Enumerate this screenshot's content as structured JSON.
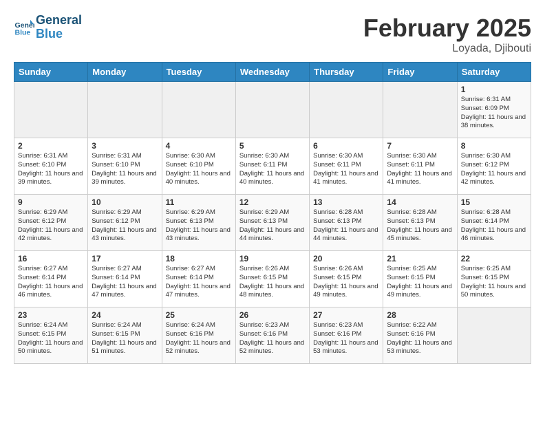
{
  "header": {
    "logo_line1": "General",
    "logo_line2": "Blue",
    "title": "February 2025",
    "subtitle": "Loyada, Djibouti"
  },
  "weekdays": [
    "Sunday",
    "Monday",
    "Tuesday",
    "Wednesday",
    "Thursday",
    "Friday",
    "Saturday"
  ],
  "weeks": [
    [
      {
        "day": "",
        "info": ""
      },
      {
        "day": "",
        "info": ""
      },
      {
        "day": "",
        "info": ""
      },
      {
        "day": "",
        "info": ""
      },
      {
        "day": "",
        "info": ""
      },
      {
        "day": "",
        "info": ""
      },
      {
        "day": "1",
        "info": "Sunrise: 6:31 AM\nSunset: 6:09 PM\nDaylight: 11 hours and 38 minutes."
      }
    ],
    [
      {
        "day": "2",
        "info": "Sunrise: 6:31 AM\nSunset: 6:10 PM\nDaylight: 11 hours and 39 minutes."
      },
      {
        "day": "3",
        "info": "Sunrise: 6:31 AM\nSunset: 6:10 PM\nDaylight: 11 hours and 39 minutes."
      },
      {
        "day": "4",
        "info": "Sunrise: 6:30 AM\nSunset: 6:10 PM\nDaylight: 11 hours and 40 minutes."
      },
      {
        "day": "5",
        "info": "Sunrise: 6:30 AM\nSunset: 6:11 PM\nDaylight: 11 hours and 40 minutes."
      },
      {
        "day": "6",
        "info": "Sunrise: 6:30 AM\nSunset: 6:11 PM\nDaylight: 11 hours and 41 minutes."
      },
      {
        "day": "7",
        "info": "Sunrise: 6:30 AM\nSunset: 6:11 PM\nDaylight: 11 hours and 41 minutes."
      },
      {
        "day": "8",
        "info": "Sunrise: 6:30 AM\nSunset: 6:12 PM\nDaylight: 11 hours and 42 minutes."
      }
    ],
    [
      {
        "day": "9",
        "info": "Sunrise: 6:29 AM\nSunset: 6:12 PM\nDaylight: 11 hours and 42 minutes."
      },
      {
        "day": "10",
        "info": "Sunrise: 6:29 AM\nSunset: 6:12 PM\nDaylight: 11 hours and 43 minutes."
      },
      {
        "day": "11",
        "info": "Sunrise: 6:29 AM\nSunset: 6:13 PM\nDaylight: 11 hours and 43 minutes."
      },
      {
        "day": "12",
        "info": "Sunrise: 6:29 AM\nSunset: 6:13 PM\nDaylight: 11 hours and 44 minutes."
      },
      {
        "day": "13",
        "info": "Sunrise: 6:28 AM\nSunset: 6:13 PM\nDaylight: 11 hours and 44 minutes."
      },
      {
        "day": "14",
        "info": "Sunrise: 6:28 AM\nSunset: 6:13 PM\nDaylight: 11 hours and 45 minutes."
      },
      {
        "day": "15",
        "info": "Sunrise: 6:28 AM\nSunset: 6:14 PM\nDaylight: 11 hours and 46 minutes."
      }
    ],
    [
      {
        "day": "16",
        "info": "Sunrise: 6:27 AM\nSunset: 6:14 PM\nDaylight: 11 hours and 46 minutes."
      },
      {
        "day": "17",
        "info": "Sunrise: 6:27 AM\nSunset: 6:14 PM\nDaylight: 11 hours and 47 minutes."
      },
      {
        "day": "18",
        "info": "Sunrise: 6:27 AM\nSunset: 6:14 PM\nDaylight: 11 hours and 47 minutes."
      },
      {
        "day": "19",
        "info": "Sunrise: 6:26 AM\nSunset: 6:15 PM\nDaylight: 11 hours and 48 minutes."
      },
      {
        "day": "20",
        "info": "Sunrise: 6:26 AM\nSunset: 6:15 PM\nDaylight: 11 hours and 49 minutes."
      },
      {
        "day": "21",
        "info": "Sunrise: 6:25 AM\nSunset: 6:15 PM\nDaylight: 11 hours and 49 minutes."
      },
      {
        "day": "22",
        "info": "Sunrise: 6:25 AM\nSunset: 6:15 PM\nDaylight: 11 hours and 50 minutes."
      }
    ],
    [
      {
        "day": "23",
        "info": "Sunrise: 6:24 AM\nSunset: 6:15 PM\nDaylight: 11 hours and 50 minutes."
      },
      {
        "day": "24",
        "info": "Sunrise: 6:24 AM\nSunset: 6:15 PM\nDaylight: 11 hours and 51 minutes."
      },
      {
        "day": "25",
        "info": "Sunrise: 6:24 AM\nSunset: 6:16 PM\nDaylight: 11 hours and 52 minutes."
      },
      {
        "day": "26",
        "info": "Sunrise: 6:23 AM\nSunset: 6:16 PM\nDaylight: 11 hours and 52 minutes."
      },
      {
        "day": "27",
        "info": "Sunrise: 6:23 AM\nSunset: 6:16 PM\nDaylight: 11 hours and 53 minutes."
      },
      {
        "day": "28",
        "info": "Sunrise: 6:22 AM\nSunset: 6:16 PM\nDaylight: 11 hours and 53 minutes."
      },
      {
        "day": "",
        "info": ""
      }
    ]
  ]
}
